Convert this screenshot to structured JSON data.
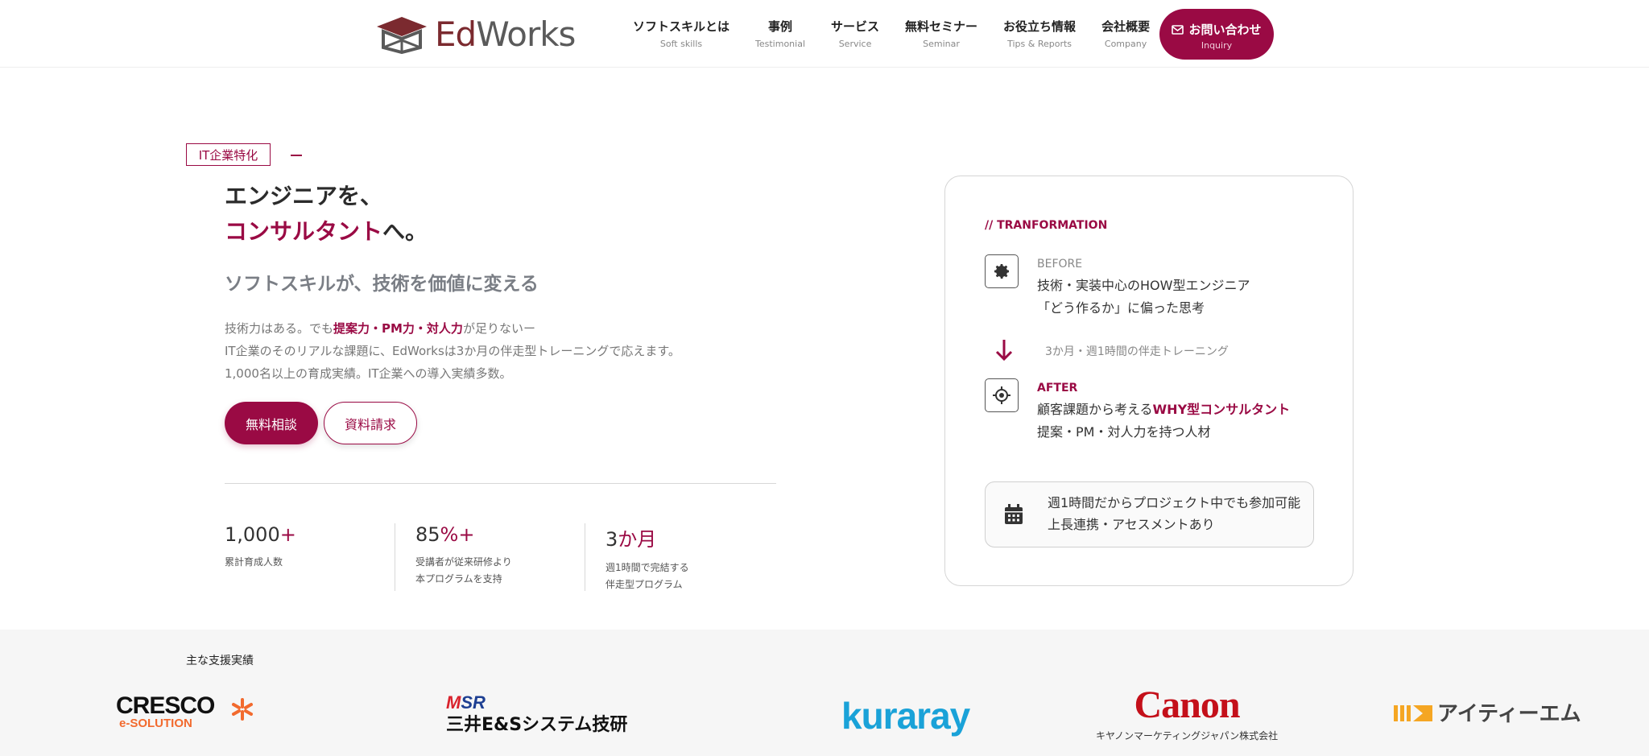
{
  "header": {
    "logo_text_a": "Ed",
    "logo_text_b": "Works",
    "nav": [
      {
        "jp": "ソフトスキルとは",
        "en": "Soft skills"
      },
      {
        "jp": "事例",
        "en": "Testimonial"
      },
      {
        "jp": "サービス",
        "en": "Service"
      },
      {
        "jp": "無料セミナー",
        "en": "Seminar"
      },
      {
        "jp": "お役立ち情報",
        "en": "Tips & Reports"
      },
      {
        "jp": "会社概要",
        "en": "Company"
      }
    ],
    "inquiry": {
      "jp": "お問い合わせ",
      "en": "Inquiry"
    }
  },
  "hero": {
    "badge": "IT企業特化",
    "title_line1": "エンジニアを、",
    "title_accent": "コンサルタント",
    "title_suffix": "へ。",
    "subtitle": "ソフトスキルが、技術を価値に変える",
    "desc_pre": "技術力はある。でも",
    "desc_hl": "提案力・PM力・対人力",
    "desc_post": "が足りないー",
    "desc_line2": "IT企業のそのリアルな課題に、EdWorksは3か月の伴走型トレーニングで応えます。",
    "desc_line3": "1,000名以上の育成実績。IT企業への導入実績多数。",
    "btn_primary": "無料相談",
    "btn_secondary": "資料請求"
  },
  "stats": [
    {
      "num": "1,000",
      "unit": "+",
      "label1": "累計育成人数",
      "label2": ""
    },
    {
      "num": "85",
      "unit": "%+",
      "label1": "受講者が従来研修より",
      "label2": "本プログラムを支持"
    },
    {
      "num": "3",
      "unit": "か月",
      "label1": "週1時間で完結する",
      "label2": "伴走型プログラム"
    }
  ],
  "card": {
    "tag": "// TRANFORMATION",
    "before_label": "BEFORE",
    "before_line1": "技術・実装中心のHOW型エンジニア",
    "before_line2": "「どう作るか」に偏った思考",
    "arrow_text": "3か月・週1時間の伴走トレーニング",
    "after_label": "AFTER",
    "after_pre": "顧客課題から考える",
    "after_hl": "WHY型コンサルタント",
    "after_line2": "提案・PM・対人力を持つ人材",
    "note_line1": "週1時間だからプロジェクト中でも参加可能",
    "note_line2": "上長連携・アセスメントあり"
  },
  "clients": {
    "title": "主な支援実績",
    "cresco_name": "CRESCO",
    "cresco_sub": "e-SOLUTION",
    "mitsui_msr_m": "M",
    "mitsui_msr_rest": "SR",
    "mitsui_name": "三井E&Sシステム技研",
    "kuraray": "kuraray",
    "canon_name": "Canon",
    "canon_sub": "キヤノンマーケティングジャパン株式会社",
    "itm_name": "アイティーエム"
  },
  "colors": {
    "accent": "#9a0a44",
    "logo": "#7b2a2f",
    "kuraray": "#1aa2d8",
    "canon": "#c4101a",
    "cresco_orange": "#f26a2e",
    "itm": "#f5a623"
  },
  "icons": {
    "inquiry": "mail-icon",
    "before": "gear-icon",
    "arrow": "arrow-down-icon",
    "after": "target-icon",
    "note": "calendar-icon"
  }
}
